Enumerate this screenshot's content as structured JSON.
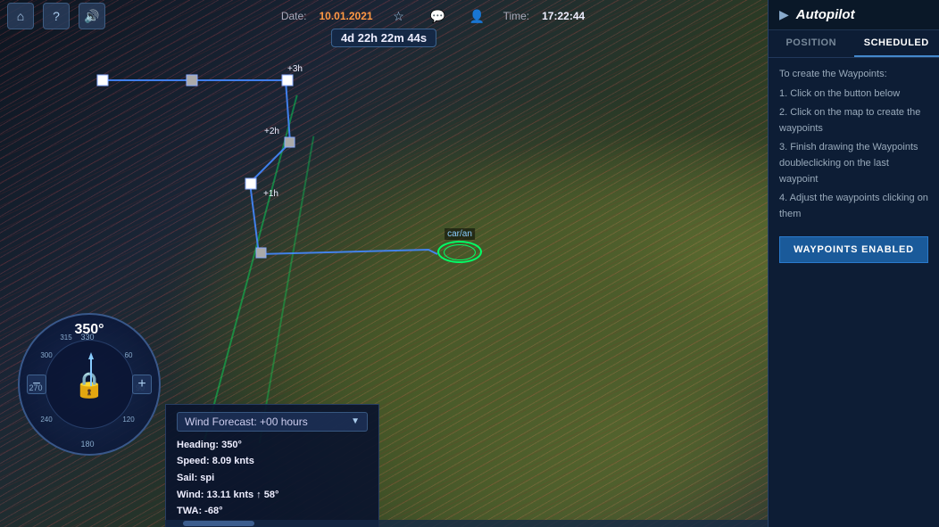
{
  "header": {
    "date_label": "Date:",
    "date_value": "10.01.2021",
    "time_label": "Time:",
    "time_value": "17:22:44",
    "countdown": "4d 22h 22m 44s"
  },
  "toolbar": {
    "home_icon": "⌂",
    "help_icon": "?",
    "sound_icon": "🔊",
    "star_icon": "☆",
    "chat_icon": "💬",
    "user_icon": "👤"
  },
  "compass": {
    "degree": "350°",
    "minus_label": "−",
    "plus_label": "+"
  },
  "wind_panel": {
    "dropdown_label": "Wind Forecast: +00 hours",
    "heading_label": "Heading:",
    "heading_value": "350°",
    "speed_label": "Speed:",
    "speed_value": "8.09 knts",
    "sail_label": "Sail:",
    "sail_value": "spi",
    "wind_label": "Wind:",
    "wind_value": "13.11 knts ↑ 58°",
    "twa_label": "TWA:",
    "twa_value": "-68°"
  },
  "ship": {
    "name": "car/an"
  },
  "waypoints": {
    "labels": [
      "+3h",
      "+2h",
      "+1h"
    ]
  },
  "autopilot": {
    "title": "Autopilot",
    "expand_arrow": "▶",
    "tab_position": "POSITION",
    "tab_scheduled": "SCHEDULED",
    "active_tab": "scheduled",
    "instructions": [
      "To create the Waypoints:",
      "1. Click on the button below",
      "2. Click on the map to create the waypoints",
      "3. Finish drawing the Waypoints doubleclicking on the last waypoint",
      "4. Adjust the waypoints clicking on them"
    ],
    "waypoints_btn": "WAYPOINTS ENABLED"
  }
}
